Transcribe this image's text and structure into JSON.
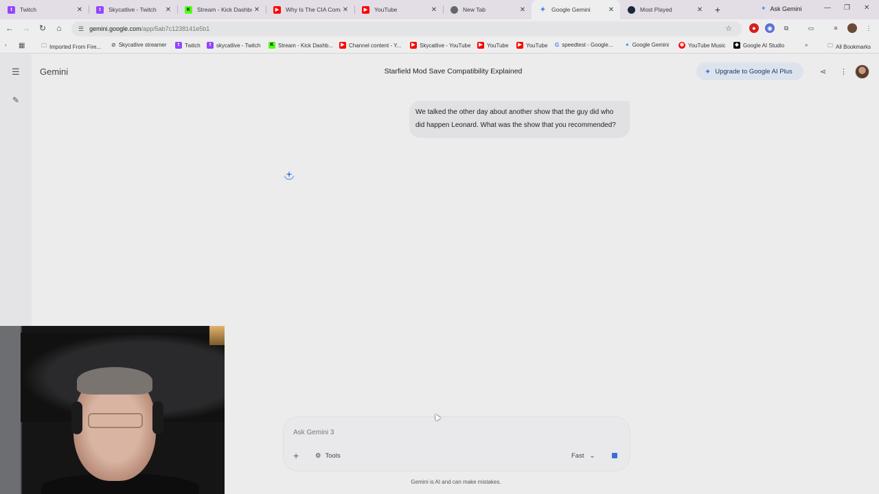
{
  "browser": {
    "tabs": [
      {
        "title": "Twitch",
        "icon": "twitch-icon",
        "color": "#9146ff"
      },
      {
        "title": "Skycatlive - Twitch",
        "icon": "twitch-icon",
        "color": "#9146ff"
      },
      {
        "title": "Stream - Kick Dashboard",
        "icon": "kick-icon",
        "color": "#53fc18"
      },
      {
        "title": "Why Is The CIA Compr...",
        "icon": "youtube-icon",
        "color": "#ff0000"
      },
      {
        "title": "YouTube",
        "icon": "youtube-icon",
        "color": "#ff0000"
      },
      {
        "title": "New Tab",
        "icon": "chrome-icon",
        "color": "#666666"
      },
      {
        "title": "Google Gemini",
        "icon": "gemini-icon",
        "color": "#4285f4",
        "active": true
      },
      {
        "title": "Most Played",
        "icon": "steam-icon",
        "color": "#1b2838"
      }
    ],
    "ask_gemini_label": "Ask Gemini",
    "url_host": "gemini.google.com",
    "url_path": "/app/5ab7c1238141e5b1",
    "bookmarks": [
      {
        "label": "Imported From Fire...",
        "icon": "folder-icon"
      },
      {
        "label": "Skycatlive streamer",
        "icon": "link-icon"
      },
      {
        "label": "Twitch",
        "icon": "twitch-icon"
      },
      {
        "label": "skycatlive - Twitch",
        "icon": "twitch-icon"
      },
      {
        "label": "Stream - Kick Dashb...",
        "icon": "kick-icon"
      },
      {
        "label": "Channel content - Y...",
        "icon": "youtube-icon"
      },
      {
        "label": "Skycatlive - YouTube",
        "icon": "youtube-icon"
      },
      {
        "label": "YouTube",
        "icon": "youtube-icon"
      },
      {
        "label": "YouTube",
        "icon": "youtube-icon"
      },
      {
        "label": "speedtest - Google...",
        "icon": "google-icon"
      },
      {
        "label": "Google Gemini",
        "icon": "gemini-icon"
      },
      {
        "label": "YouTube Music",
        "icon": "youtube-music-icon"
      },
      {
        "label": "Google AI Studio",
        "icon": "ai-studio-icon"
      }
    ],
    "all_bookmarks_label": "All Bookmarks"
  },
  "gemini": {
    "brand": "Gemini",
    "conversation_title": "Starfield Mod Save Compatibility Explained",
    "upgrade_label": "Upgrade to Google AI Plus",
    "user_message": "We talked the other day about another show that the guy did who did happen Leonard. What was the show that you recommended?",
    "input_placeholder": "Ask Gemini 3",
    "tools_label": "Tools",
    "mode_label": "Fast",
    "disclaimer": "Gemini is AI and can make mistakes."
  },
  "colors": {
    "accent": "#3b6fd8",
    "upgrade_bg": "#dce3ec"
  }
}
